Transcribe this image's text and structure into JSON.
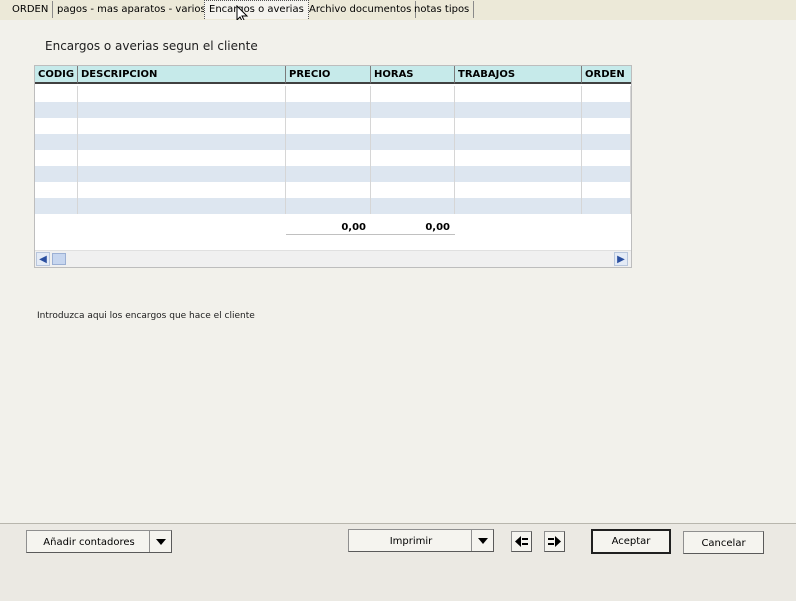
{
  "tabs": [
    {
      "label": "ORDEN",
      "active": false
    },
    {
      "label": "pagos - mas aparatos - varios",
      "active": false
    },
    {
      "label": "Encargos o averias",
      "active": true
    },
    {
      "label": "Archivo documentos",
      "active": false
    },
    {
      "label": "notas tipos",
      "active": false
    }
  ],
  "panel": {
    "title": "Encargos o averias segun el cliente",
    "hint": "Introduzca aqui los encargos que hace el cliente"
  },
  "grid": {
    "columns": [
      "CODIG",
      "DESCRIPCION",
      "PRECIO",
      "HORAS",
      "TRABAJOS",
      "ORDEN"
    ],
    "rows": [
      [
        "",
        "",
        "",
        "",
        "",
        ""
      ],
      [
        "",
        "",
        "",
        "",
        "",
        ""
      ],
      [
        "",
        "",
        "",
        "",
        "",
        ""
      ],
      [
        "",
        "",
        "",
        "",
        "",
        ""
      ],
      [
        "",
        "",
        "",
        "",
        "",
        ""
      ],
      [
        "",
        "",
        "",
        "",
        "",
        ""
      ],
      [
        "",
        "",
        "",
        "",
        "",
        ""
      ],
      [
        "",
        "",
        "",
        "",
        "",
        ""
      ]
    ],
    "totals": {
      "precio": "0,00",
      "horas": "0,00"
    },
    "header_color": "#c6eaea",
    "alt_row_color": "#dde6f0"
  },
  "bottom": {
    "anadir_label": "Añadir contadores",
    "imprimir_label": "Imprimir",
    "aceptar_label": "Aceptar",
    "cancelar_label": "Cancelar"
  },
  "icons": {
    "prev": "arrow-left-icon",
    "next": "arrow-right-icon",
    "scroll_left": "scroll-left-icon",
    "scroll_right": "scroll-right-icon"
  }
}
